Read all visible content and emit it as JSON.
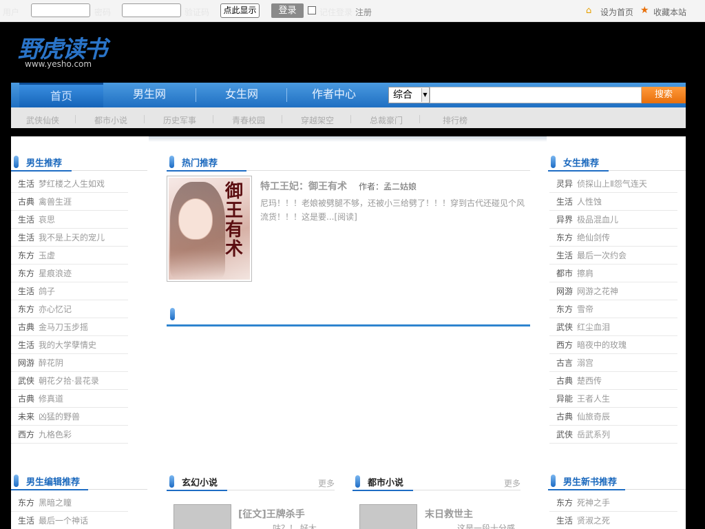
{
  "topbar": {
    "username_label": "用户",
    "password_label": "密码",
    "code_label": "验证码",
    "show_button": "点此显示",
    "login_button": "登录",
    "remember_label": "记住登录",
    "register": "注册",
    "set_home": "设为首页",
    "bookmark": "收藏本站"
  },
  "logo": {
    "text": "野虎读书",
    "url": "www.yesho.com"
  },
  "nav": {
    "items": [
      "首页",
      "男生网",
      "女生网",
      "作者中心"
    ],
    "search_select": "综合",
    "search_button": "搜索"
  },
  "subnav": [
    "武侠仙侠",
    "都市小说",
    "历史军事",
    "青春校园",
    "穿越架空",
    "总裁豪门",
    "排行榜"
  ],
  "left": {
    "title": "男生推荐",
    "items": [
      {
        "cat": "生活",
        "name": "梦红楼之人生如戏"
      },
      {
        "cat": "古典",
        "name": "禽兽生涯"
      },
      {
        "cat": "生活",
        "name": "哀思"
      },
      {
        "cat": "生活",
        "name": "我不是上天的宠儿"
      },
      {
        "cat": "东方",
        "name": "玉虚"
      },
      {
        "cat": "东方",
        "name": "星痕浪迹"
      },
      {
        "cat": "生活",
        "name": "鸽子"
      },
      {
        "cat": "东方",
        "name": "亦心忆记"
      },
      {
        "cat": "古典",
        "name": "金马刀玉步摇"
      },
      {
        "cat": "生活",
        "name": "我的大学孽情史"
      },
      {
        "cat": "网游",
        "name": "醉花阴"
      },
      {
        "cat": "武侠",
        "name": "朝花夕拾·昙花录"
      },
      {
        "cat": "古典",
        "name": "修真道"
      },
      {
        "cat": "未来",
        "name": "凶猛的野兽"
      },
      {
        "cat": "西方",
        "name": "九格色彩"
      }
    ],
    "title2": "男生编辑推荐",
    "items2": [
      {
        "cat": "东方",
        "name": "黑暗之瞳"
      },
      {
        "cat": "生活",
        "name": "最后一个神话"
      }
    ]
  },
  "middle": {
    "title": "热门推荐",
    "hot": {
      "cover_title": "御王有术",
      "title": "特工王妃：御王有术",
      "author": "作者：孟二姑娘",
      "desc": "尼玛！！！老娘被劈腿不够，还被小三给劈了！！！穿到古代还碰见个风流货！！！这是要...[阅读]"
    },
    "sec1": {
      "title": "玄幻小说",
      "more": "更多",
      "book": "[征文]王牌杀手",
      "desc": "咕？！ 好大"
    },
    "sec2": {
      "title": "都市小说",
      "more": "更多",
      "book": "末日救世主",
      "desc": "这是一段十分感"
    }
  },
  "right": {
    "title": "女生推荐",
    "items": [
      {
        "cat": "灵异",
        "name": "侦探山上Ⅱ怨气连天"
      },
      {
        "cat": "生活",
        "name": "人性蚀"
      },
      {
        "cat": "异界",
        "name": "极品混血儿"
      },
      {
        "cat": "东方",
        "name": "绝仙剑传"
      },
      {
        "cat": "生活",
        "name": "最后一次约会"
      },
      {
        "cat": "都市",
        "name": "擦肩"
      },
      {
        "cat": "网游",
        "name": "网游之花神"
      },
      {
        "cat": "东方",
        "name": "雪帝"
      },
      {
        "cat": "武侠",
        "name": "红尘血泪"
      },
      {
        "cat": "西方",
        "name": "暗夜中的玫瑰"
      },
      {
        "cat": "古言",
        "name": "溺宫"
      },
      {
        "cat": "古典",
        "name": "楚西传"
      },
      {
        "cat": "异能",
        "name": "王者人生"
      },
      {
        "cat": "古典",
        "name": "仙旅奇辰"
      },
      {
        "cat": "武侠",
        "name": "岳武系列"
      }
    ],
    "title2": "男生新书推荐",
    "items2": [
      {
        "cat": "东方",
        "name": "死神之手"
      },
      {
        "cat": "生活",
        "name": "贤淑之死"
      }
    ]
  }
}
